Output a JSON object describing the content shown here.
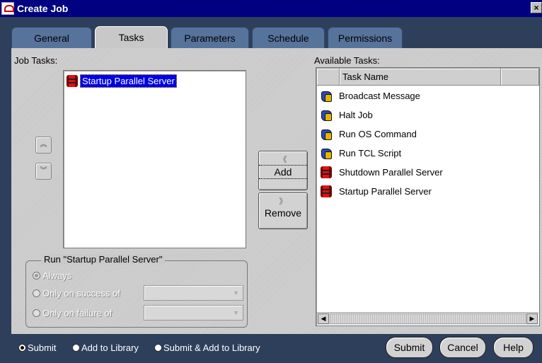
{
  "window": {
    "title": "Create Job",
    "close_glyph": "×"
  },
  "tabs": [
    {
      "label": "General",
      "active": false
    },
    {
      "label": "Tasks",
      "active": true
    },
    {
      "label": "Parameters",
      "active": false
    },
    {
      "label": "Schedule",
      "active": false
    },
    {
      "label": "Permissions",
      "active": false
    }
  ],
  "job_tasks": {
    "label": "Job Tasks:",
    "items": [
      {
        "label": "Startup Parallel Server",
        "icon": "database-barrel-icon",
        "selected": true
      }
    ],
    "move_up_glyph": "︽",
    "move_down_glyph": "︾"
  },
  "actions": {
    "add": {
      "glyph": "《",
      "label": "Add"
    },
    "remove": {
      "glyph": "》",
      "label": "Remove"
    }
  },
  "run_group": {
    "label": "Run \"Startup Parallel Server\"",
    "options": [
      {
        "label": "Always",
        "selected": true
      },
      {
        "label": "Only on success of",
        "selected": false
      },
      {
        "label": "Only on failure of",
        "selected": false
      }
    ]
  },
  "available_tasks": {
    "label": "Available Tasks:",
    "column_header": "Task Name",
    "items": [
      {
        "label": "Broadcast Message",
        "icon": "puzzle-icon"
      },
      {
        "label": "Halt Job",
        "icon": "puzzle-icon"
      },
      {
        "label": "Run OS Command",
        "icon": "puzzle-icon"
      },
      {
        "label": "Run TCL Script",
        "icon": "puzzle-icon"
      },
      {
        "label": "Shutdown Parallel Server",
        "icon": "database-barrel-icon"
      },
      {
        "label": "Startup Parallel Server",
        "icon": "database-barrel-icon"
      }
    ]
  },
  "footer": {
    "submit_options": [
      {
        "label": "Submit",
        "selected": true
      },
      {
        "label": "Add to Library",
        "selected": false
      },
      {
        "label": "Submit & Add to Library",
        "selected": false
      }
    ],
    "buttons": {
      "submit": "Submit",
      "cancel": "Cancel",
      "help": "Help"
    }
  },
  "colors": {
    "title_bar": "#000080",
    "background": "#2e3f5b",
    "selection": "#0000e6",
    "panel": "#c9c9c9"
  }
}
